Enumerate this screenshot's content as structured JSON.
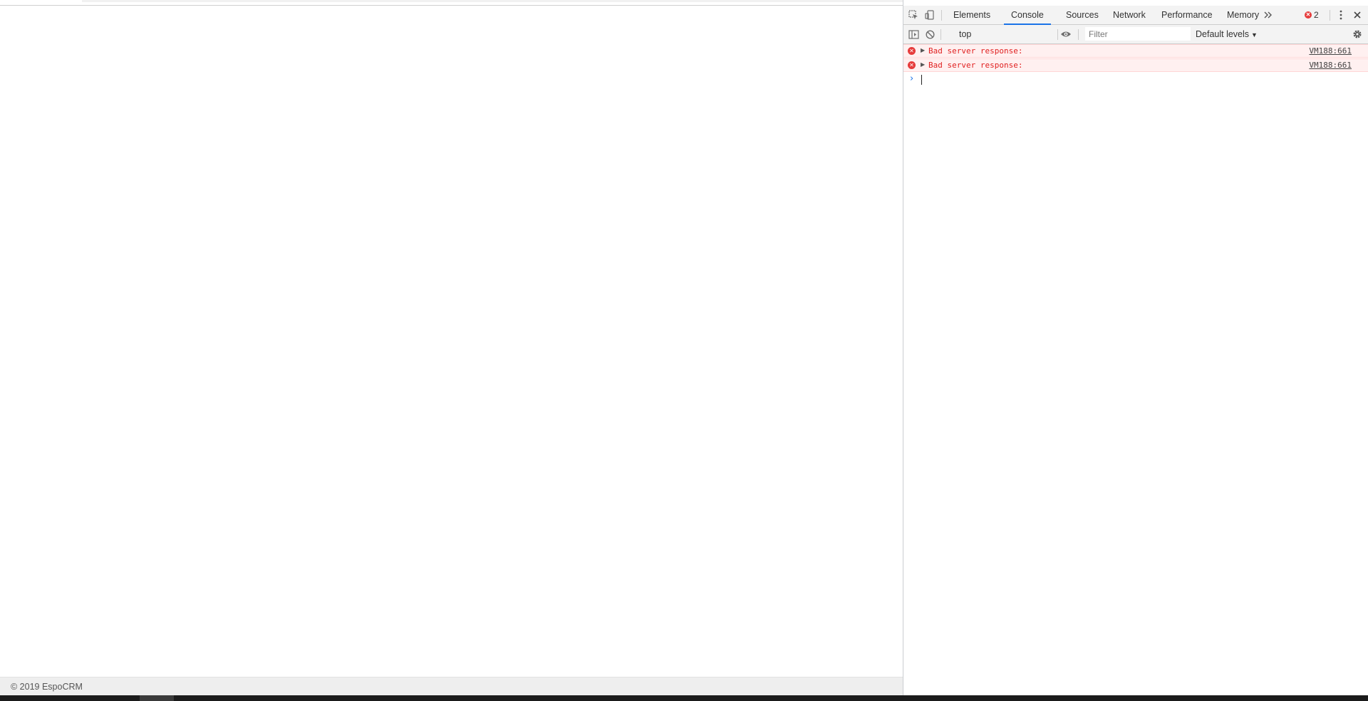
{
  "page": {
    "footer_text": "© 2019 EspoCRM"
  },
  "devtools": {
    "tabs": [
      {
        "label": "Elements"
      },
      {
        "label": "Console"
      },
      {
        "label": "Sources"
      },
      {
        "label": "Network"
      },
      {
        "label": "Performance"
      },
      {
        "label": "Memory"
      }
    ],
    "active_tab": "Console",
    "more_tabs_icon": "chevron-double-right-icon",
    "error_count": "2",
    "toolbar": {
      "context": "top",
      "filter_placeholder": "Filter",
      "levels": "Default levels"
    },
    "messages": [
      {
        "text": "Bad server response:",
        "source": "VM188:661",
        "level": "error"
      },
      {
        "text": "Bad server response:",
        "source": "VM188:661",
        "level": "error"
      }
    ],
    "prompt_symbol": "›"
  },
  "colors": {
    "error_text": "#e02020",
    "error_bg": "#fff0f0",
    "accent": "#1a73e8"
  }
}
